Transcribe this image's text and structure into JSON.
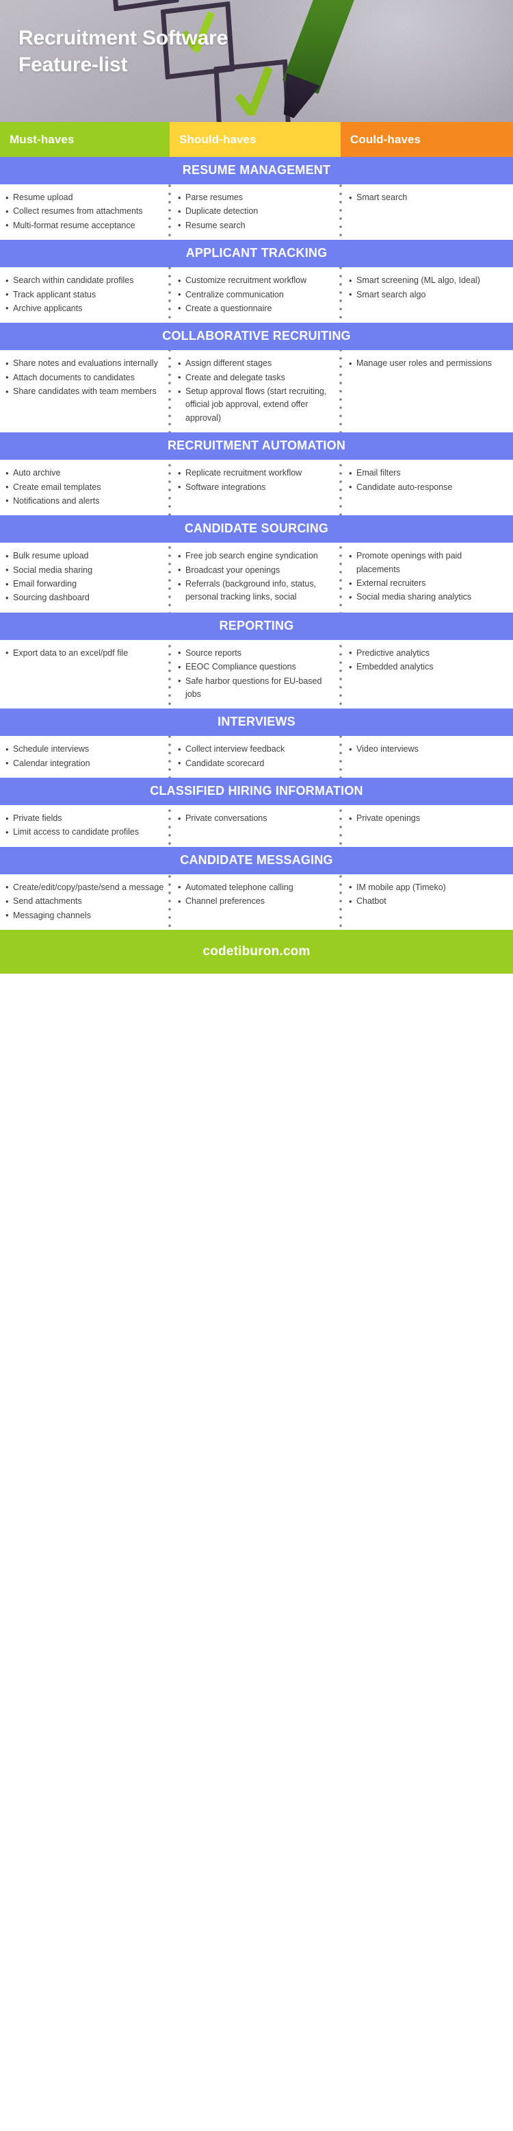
{
  "header": {
    "title": "Recruitment Software\nFeature-list",
    "image_alt": "checkbox-checklist-photo"
  },
  "categories": [
    {
      "label": "Must-haves",
      "color": "#9ACD22"
    },
    {
      "label": "Should-haves",
      "color": "#FFD43B"
    },
    {
      "label": "Could-haves",
      "color": "#F5891F"
    }
  ],
  "theme": {
    "section_header_color": "#7080F0",
    "footer_color": "#9ACD22",
    "body_text_color": "#3f3f3f",
    "divider_color": "#7b7b7b"
  },
  "sections": [
    {
      "title": "RESUME MANAGEMENT",
      "must": [
        "Resume upload",
        "Collect resumes from attachments",
        "Multi-format resume acceptance"
      ],
      "should": [
        "Parse resumes",
        "Duplicate detection",
        "Resume search"
      ],
      "could": [
        "Smart search"
      ]
    },
    {
      "title": "APPLICANT TRACKING",
      "must": [
        "Search within candidate profiles",
        "Track applicant status",
        "Archive applicants"
      ],
      "should": [
        "Customize recruitment workflow",
        "Centralize communication",
        "Create a questionnaire"
      ],
      "could": [
        "Smart screening (ML algo, Ideal)",
        "Smart search algo"
      ]
    },
    {
      "title": "COLLABORATIVE RECRUITING",
      "must": [
        "Share notes and evaluations internally",
        "Attach documents to candidates",
        "Share candidates with team members"
      ],
      "should": [
        "Assign different stages",
        "Create and delegate tasks",
        "Setup approval flows (start recruiting, official job approval, extend offer approval)"
      ],
      "could": [
        "Manage user roles and permissions"
      ]
    },
    {
      "title": "RECRUITMENT AUTOMATION",
      "must": [
        "Auto archive",
        "Create email templates",
        "Notifications and alerts"
      ],
      "should": [
        "Replicate recruitment workflow",
        "Software integrations"
      ],
      "could": [
        "Email filters",
        "Candidate auto-response"
      ]
    },
    {
      "title": "CANDIDATE SOURCING",
      "must": [
        "Bulk resume upload",
        "Social media sharing",
        "Email forwarding",
        "Sourcing dashboard"
      ],
      "should": [
        "Free job search engine syndication",
        "Broadcast your openings",
        "Referrals (background info, status, personal tracking links, social"
      ],
      "could": [
        "Promote openings with paid placements",
        "External recruiters",
        "Social media sharing analytics"
      ]
    },
    {
      "title": "REPORTING",
      "must": [
        "Export data to an excel/pdf file"
      ],
      "should": [
        "Source reports",
        "EEOC Compliance questions",
        "Safe harbor questions for EU-based jobs"
      ],
      "could": [
        "Predictive analytics",
        "Embedded analytics"
      ]
    },
    {
      "title": "INTERVIEWS",
      "must": [
        "Schedule interviews",
        "Calendar integration"
      ],
      "should": [
        "Collect interview feedback",
        "Candidate scorecard"
      ],
      "could": [
        "Video interviews"
      ]
    },
    {
      "title": "CLASSIFIED HIRING INFORMATION",
      "must": [
        "Private fields",
        "Limit access to candidate profiles"
      ],
      "should": [
        "Private conversations"
      ],
      "could": [
        "Private openings"
      ]
    },
    {
      "title": "CANDIDATE MESSAGING",
      "must": [
        "Create/edit/copy/paste/send a message",
        "Send attachments",
        "Messaging channels"
      ],
      "should": [
        "Automated telephone calling",
        "Channel preferences"
      ],
      "could": [
        "IM mobile app (Timeko)",
        "Chatbot"
      ]
    }
  ],
  "footer": {
    "website": "codetiburon.com"
  }
}
